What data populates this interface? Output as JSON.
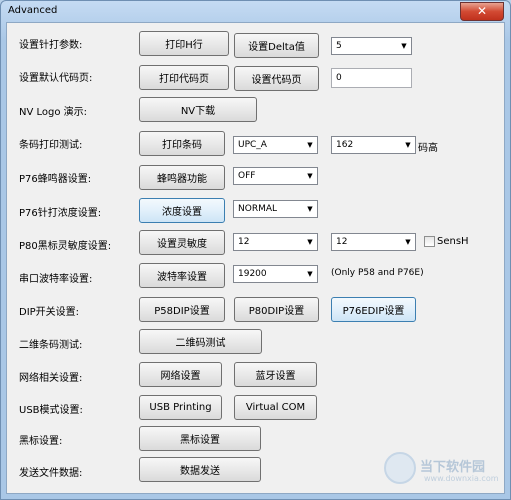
{
  "window": {
    "title": "Advanced",
    "close_label": "✕"
  },
  "rows": {
    "pin_params": {
      "label": "设置针打参数:",
      "button1": "打印H行",
      "button2": "设置Delta值",
      "combo_value": "5"
    },
    "default_codepage": {
      "label": "设置默认代码页:",
      "button1": "打印代码页",
      "button2": "设置代码页",
      "input_value": "0"
    },
    "nv_logo": {
      "label": "NV Logo 演示:",
      "button1": "NV下载"
    },
    "barcode": {
      "label": "条码打印测试:",
      "button1": "打印条码",
      "combo1_value": "UPC_A",
      "combo2_value": "162",
      "suffix": "码高"
    },
    "buzzer": {
      "label": "P76蜂鸣器设置:",
      "button1": "蜂鸣器功能",
      "combo_value": "OFF"
    },
    "density": {
      "label": "P76针打浓度设置:",
      "button1": "浓度设置",
      "combo_value": "NORMAL"
    },
    "blackmark_sens": {
      "label": "P80黑标灵敏度设置:",
      "button1": "设置灵敏度",
      "combo1_value": "12",
      "combo2_value": "12",
      "checkbox_label": "SensH"
    },
    "baud": {
      "label": "串口波特率设置:",
      "button1": "波特率设置",
      "combo_value": "19200",
      "note": "(Only P58 and P76E)"
    },
    "dip": {
      "label": "DIP开关设置:",
      "button1": "P58DIP设置",
      "button2": "P80DIP设置",
      "button3": "P76EDIP设置"
    },
    "qrcode": {
      "label": "二维条码测试:",
      "button1": "二维码测试"
    },
    "network": {
      "label": "网络相关设置:",
      "button1": "网络设置",
      "button2": "蓝牙设置"
    },
    "usb": {
      "label": "USB模式设置:",
      "button1": "USB Printing",
      "button2": "Virtual COM"
    },
    "blackmark": {
      "label": "黑标设置:",
      "button1": "黑标设置"
    },
    "send_file": {
      "label": "发送文件数据:",
      "button1": "数据发送"
    }
  },
  "watermark": {
    "text1": "当下软件园",
    "text2": "www.downxia.com"
  },
  "icons": {
    "dropdown": "chevron-down-icon"
  }
}
